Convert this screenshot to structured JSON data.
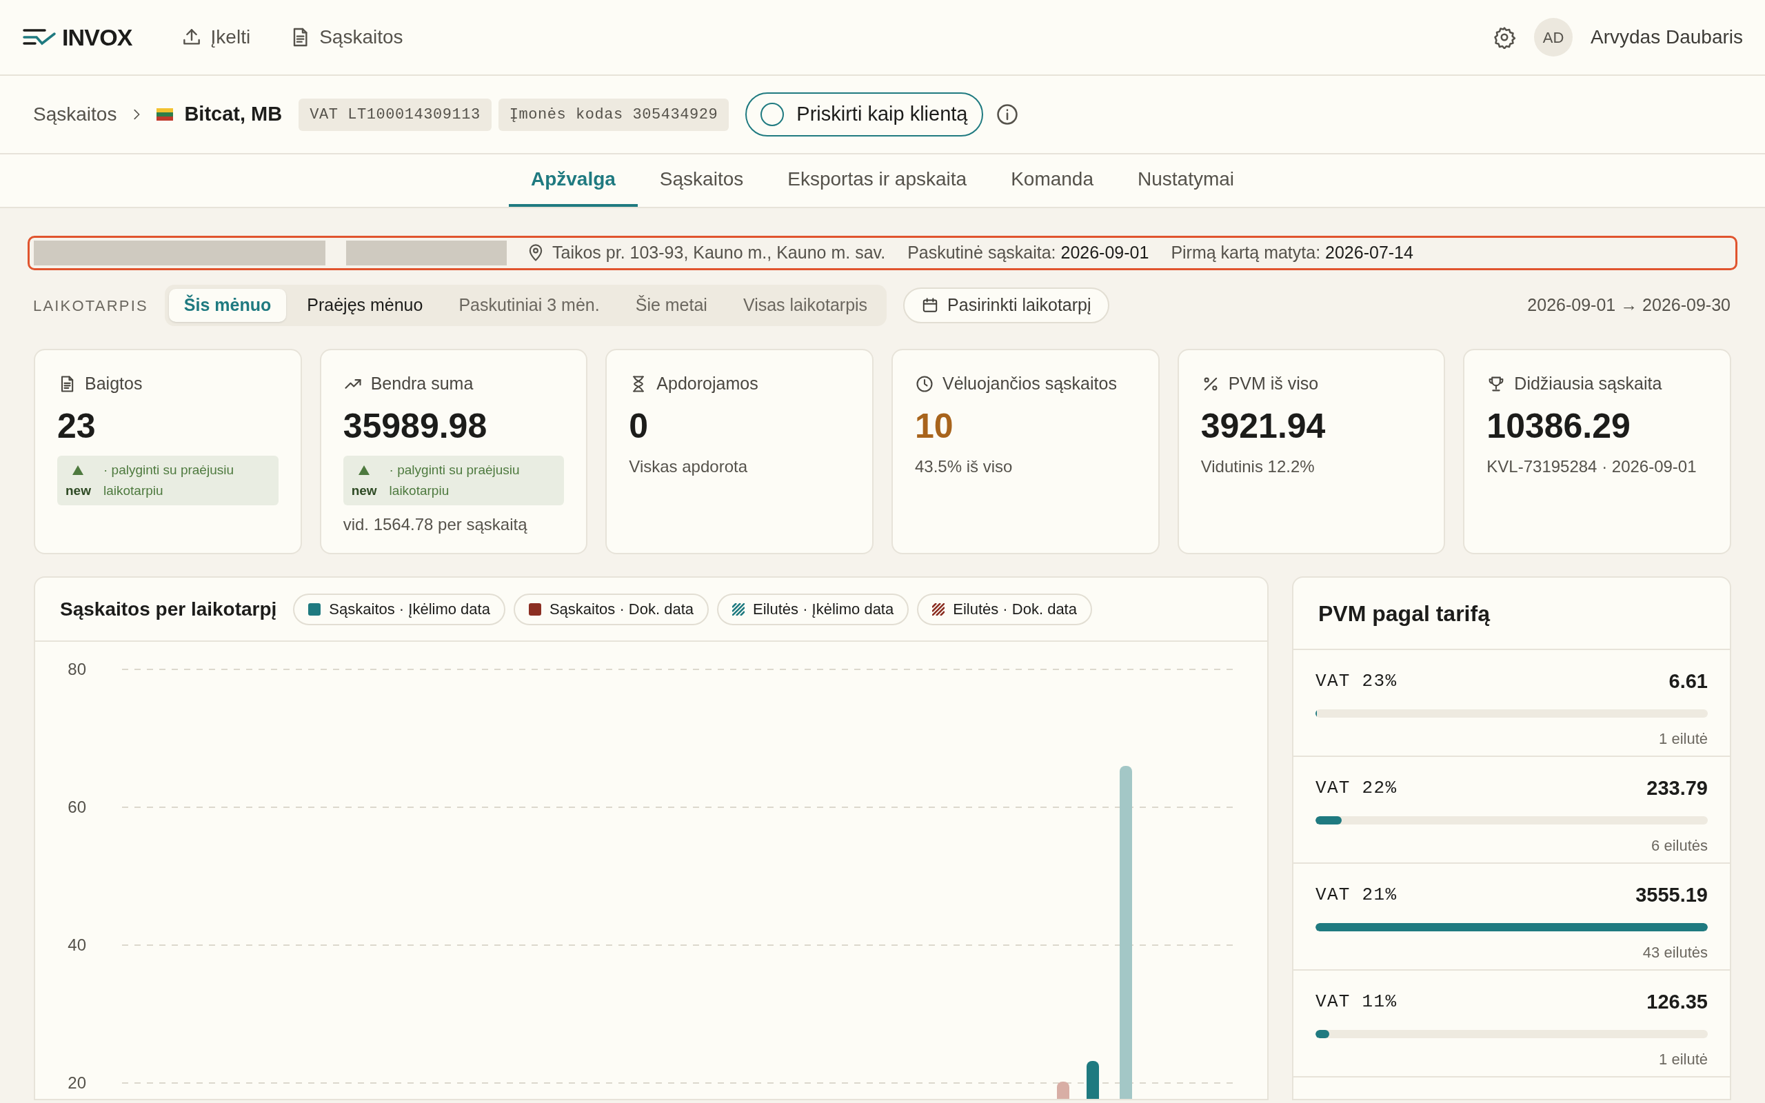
{
  "header": {
    "logo": "INVOX",
    "nav": [
      {
        "kind": "upload",
        "label": "Įkelti"
      },
      {
        "kind": "document",
        "label": "Sąskaitos"
      }
    ],
    "user": {
      "initials": "AD",
      "name": "Arvydas Daubaris"
    }
  },
  "breadcrumb": {
    "root": "Sąskaitos",
    "company": "Bitcat, MB",
    "badges": [
      "VAT LT100014309113",
      "Įmonės kodas 305434929"
    ],
    "assign_button": "Priskirti kaip klientą"
  },
  "tabs": [
    {
      "label": "Apžvalga",
      "selected": true
    },
    {
      "label": "Sąskaitos",
      "selected": false
    },
    {
      "label": "Eksportas ir apskaita",
      "selected": false
    },
    {
      "label": "Komanda",
      "selected": false
    },
    {
      "label": "Nustatymai",
      "selected": false
    }
  ],
  "info_bar": {
    "items": [
      {
        "kind": "redacted"
      },
      {
        "kind": "redacted"
      },
      {
        "kind": "address",
        "text": "Taikos pr. 103-93, Kauno m., Kauno m. sav."
      },
      {
        "kind": "fact",
        "label": "Paskutinė sąskaita:",
        "value": "2026-09-01"
      },
      {
        "kind": "fact",
        "label": "Pirmą kartą matyta:",
        "value": "2026-07-14"
      }
    ]
  },
  "period": {
    "label": "LAIKOTARPIS",
    "options": [
      {
        "label": "Šis mėnuo",
        "selected": true
      },
      {
        "label": "Praėjęs mėnuo",
        "selected": false
      },
      {
        "label": "Paskutiniai 3 mėn.",
        "selected": false
      },
      {
        "label": "Šie metai",
        "selected": false
      },
      {
        "label": "Visas laikotarpis",
        "selected": false
      }
    ],
    "custom_button": "Pasirinkti laikotarpį",
    "range": "2026-09-01 → 2026-09-30"
  },
  "cards": [
    {
      "kind": "document",
      "title": "Baigtos",
      "value": "23",
      "warning": false,
      "comparison": {
        "badge": "new",
        "text": "· palyginti su praėjusiu laikotarpiu"
      }
    },
    {
      "kind": "trend",
      "title": "Bendra suma",
      "value": "35989.98",
      "warning": false,
      "comparison": {
        "badge": "new",
        "text": "· palyginti su praėjusiu laikotarpiu"
      },
      "note": "vid. 1564.78 per sąskaitą"
    },
    {
      "kind": "hourglass",
      "title": "Apdorojamos",
      "value": "0",
      "warning": false,
      "note": "Viskas apdorota"
    },
    {
      "kind": "clock",
      "title": "Vėluojančios sąskaitos",
      "value": "10",
      "warning": true,
      "note": "43.5% iš viso"
    },
    {
      "kind": "percent",
      "title": "PVM iš viso",
      "value": "3921.94",
      "warning": false,
      "note": "Vidutinis 12.2%"
    },
    {
      "kind": "trophy",
      "title": "Didžiausia sąskaita",
      "value": "10386.29",
      "warning": false,
      "note": "KVL-73195284 · 2026-09-01"
    }
  ],
  "chart_card": {
    "title": "Sąskaitos per laikotarpį",
    "legend": [
      {
        "kind": "solid",
        "label": "Sąskaitos · Įkėlimo data",
        "color": "#1f7a80"
      },
      {
        "kind": "solid",
        "label": "Sąskaitos · Dok. data",
        "color": "#8b2e22"
      },
      {
        "kind": "striped",
        "label": "Eilutės · Įkėlimo data",
        "color": "#1f7a80"
      },
      {
        "kind": "striped",
        "label": "Eilutės · Dok. data",
        "color": "#8b2e22"
      }
    ],
    "y_axis_labels": [
      "80",
      "60",
      "40",
      "20"
    ]
  },
  "vat_panel": {
    "title": "PVM pagal tarifą",
    "rows": [
      {
        "label": "VAT 23%",
        "amount": "6.61",
        "level": 0.004,
        "count": "1 eilutė"
      },
      {
        "label": "VAT 22%",
        "amount": "233.79",
        "level": 0.066,
        "count": "6 eilutės"
      },
      {
        "label": "VAT 21%",
        "amount": "3555.19",
        "level": 1,
        "count": "43 eilutės"
      },
      {
        "label": "VAT 11%",
        "amount": "126.35",
        "level": 0.036,
        "count": "1 eilutė"
      }
    ]
  }
}
